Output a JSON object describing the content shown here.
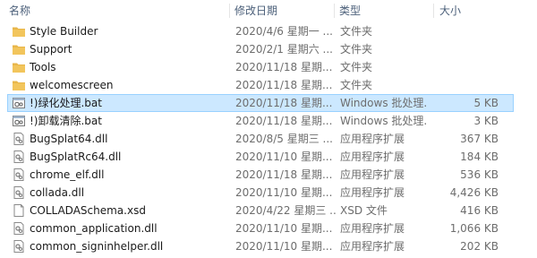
{
  "columns": {
    "name": "名称",
    "modified": "修改日期",
    "type": "类型",
    "size": "大小"
  },
  "files": [
    {
      "name": "Style Builder",
      "date": "2020/4/6 星期一 ...",
      "type": "文件夹",
      "size": "",
      "icon": "folder-icon"
    },
    {
      "name": "Support",
      "date": "2020/2/1 星期六 ...",
      "type": "文件夹",
      "size": "",
      "icon": "folder-icon"
    },
    {
      "name": "Tools",
      "date": "2020/11/18 星期...",
      "type": "文件夹",
      "size": "",
      "icon": "folder-icon"
    },
    {
      "name": "welcomescreen",
      "date": "2020/11/18 星期...",
      "type": "文件夹",
      "size": "",
      "icon": "folder-icon"
    },
    {
      "name": "!)绿化处理.bat",
      "date": "2020/11/18 星期...",
      "type": "Windows 批处理...",
      "size": "5 KB",
      "icon": "batch-file-icon",
      "selected": true
    },
    {
      "name": "!)卸载清除.bat",
      "date": "2020/11/18 星期...",
      "type": "Windows 批处理...",
      "size": "3 KB",
      "icon": "batch-file-icon"
    },
    {
      "name": "BugSplat64.dll",
      "date": "2020/8/5 星期三 ...",
      "type": "应用程序扩展",
      "size": "367 KB",
      "icon": "dll-file-icon"
    },
    {
      "name": "BugSplatRc64.dll",
      "date": "2020/11/10 星期...",
      "type": "应用程序扩展",
      "size": "184 KB",
      "icon": "dll-file-icon"
    },
    {
      "name": "chrome_elf.dll",
      "date": "2020/11/18 星期...",
      "type": "应用程序扩展",
      "size": "536 KB",
      "icon": "dll-file-icon"
    },
    {
      "name": "collada.dll",
      "date": "2020/11/10 星期...",
      "type": "应用程序扩展",
      "size": "4,426 KB",
      "icon": "dll-file-icon"
    },
    {
      "name": "COLLADASchema.xsd",
      "date": "2020/4/22 星期三 ...",
      "type": "XSD 文件",
      "size": "416 KB",
      "icon": "generic-file-icon"
    },
    {
      "name": "common_application.dll",
      "date": "2020/11/10 星期...",
      "type": "应用程序扩展",
      "size": "1,066 KB",
      "icon": "dll-file-icon"
    },
    {
      "name": "common_signinhelper.dll",
      "date": "2020/11/10 星期...",
      "type": "应用程序扩展",
      "size": "202 KB",
      "icon": "dll-file-icon"
    }
  ],
  "colors": {
    "selection_bg": "#cce8ff",
    "selection_border": "#99d1ff",
    "folder": "#f2c55c",
    "header_text": "#4c607a"
  }
}
